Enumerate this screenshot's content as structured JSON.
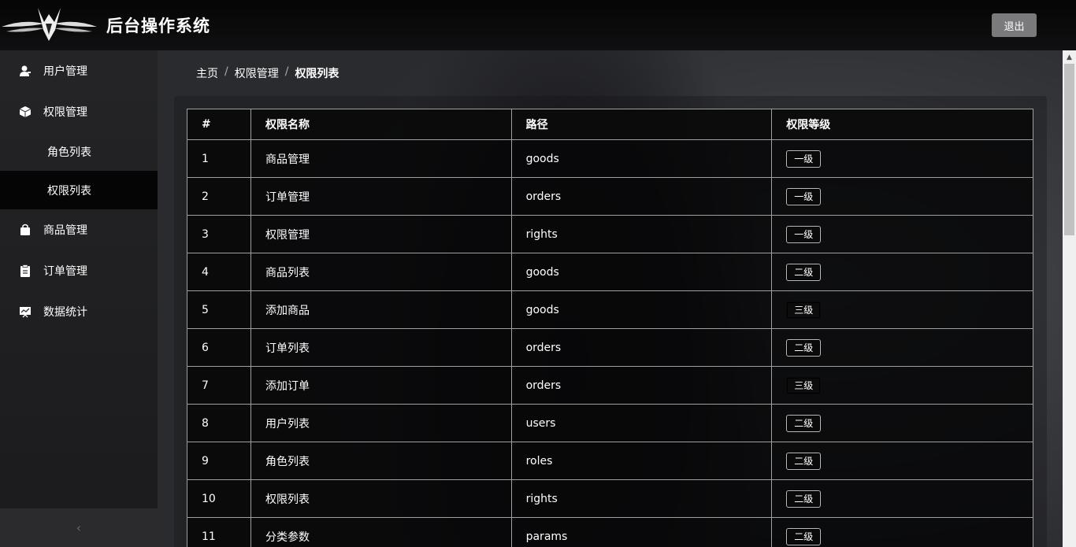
{
  "header": {
    "app_title": "后台操作系统",
    "logout_label": "退出"
  },
  "sidebar": {
    "items": [
      {
        "label": "用户管理",
        "icon": "user-icon"
      },
      {
        "label": "权限管理",
        "icon": "cube-icon"
      },
      {
        "label": "商品管理",
        "icon": "bag-icon"
      },
      {
        "label": "订单管理",
        "icon": "clipboard-icon"
      },
      {
        "label": "数据统计",
        "icon": "chart-icon"
      }
    ],
    "sub_items": [
      {
        "label": "角色列表",
        "active": false
      },
      {
        "label": "权限列表",
        "active": true
      }
    ],
    "collapse_icon": "‹"
  },
  "breadcrumb": {
    "items": [
      "主页",
      "权限管理",
      "权限列表"
    ],
    "separator": "/"
  },
  "table": {
    "headers": [
      "#",
      "权限名称",
      "路径",
      "权限等级"
    ],
    "rows": [
      {
        "idx": "1",
        "name": "商品管理",
        "path": "goods",
        "level": "一级"
      },
      {
        "idx": "2",
        "name": "订单管理",
        "path": "orders",
        "level": "一级"
      },
      {
        "idx": "3",
        "name": "权限管理",
        "path": "rights",
        "level": "一级"
      },
      {
        "idx": "4",
        "name": "商品列表",
        "path": "goods",
        "level": "二级"
      },
      {
        "idx": "5",
        "name": "添加商品",
        "path": "goods",
        "level": "三级"
      },
      {
        "idx": "6",
        "name": "订单列表",
        "path": "orders",
        "level": "二级"
      },
      {
        "idx": "7",
        "name": "添加订单",
        "path": "orders",
        "level": "三级"
      },
      {
        "idx": "8",
        "name": "用户列表",
        "path": "users",
        "level": "二级"
      },
      {
        "idx": "9",
        "name": "角色列表",
        "path": "roles",
        "level": "二级"
      },
      {
        "idx": "10",
        "name": "权限列表",
        "path": "rights",
        "level": "二级"
      },
      {
        "idx": "11",
        "name": "分类参数",
        "path": "params",
        "level": "二级"
      }
    ]
  }
}
